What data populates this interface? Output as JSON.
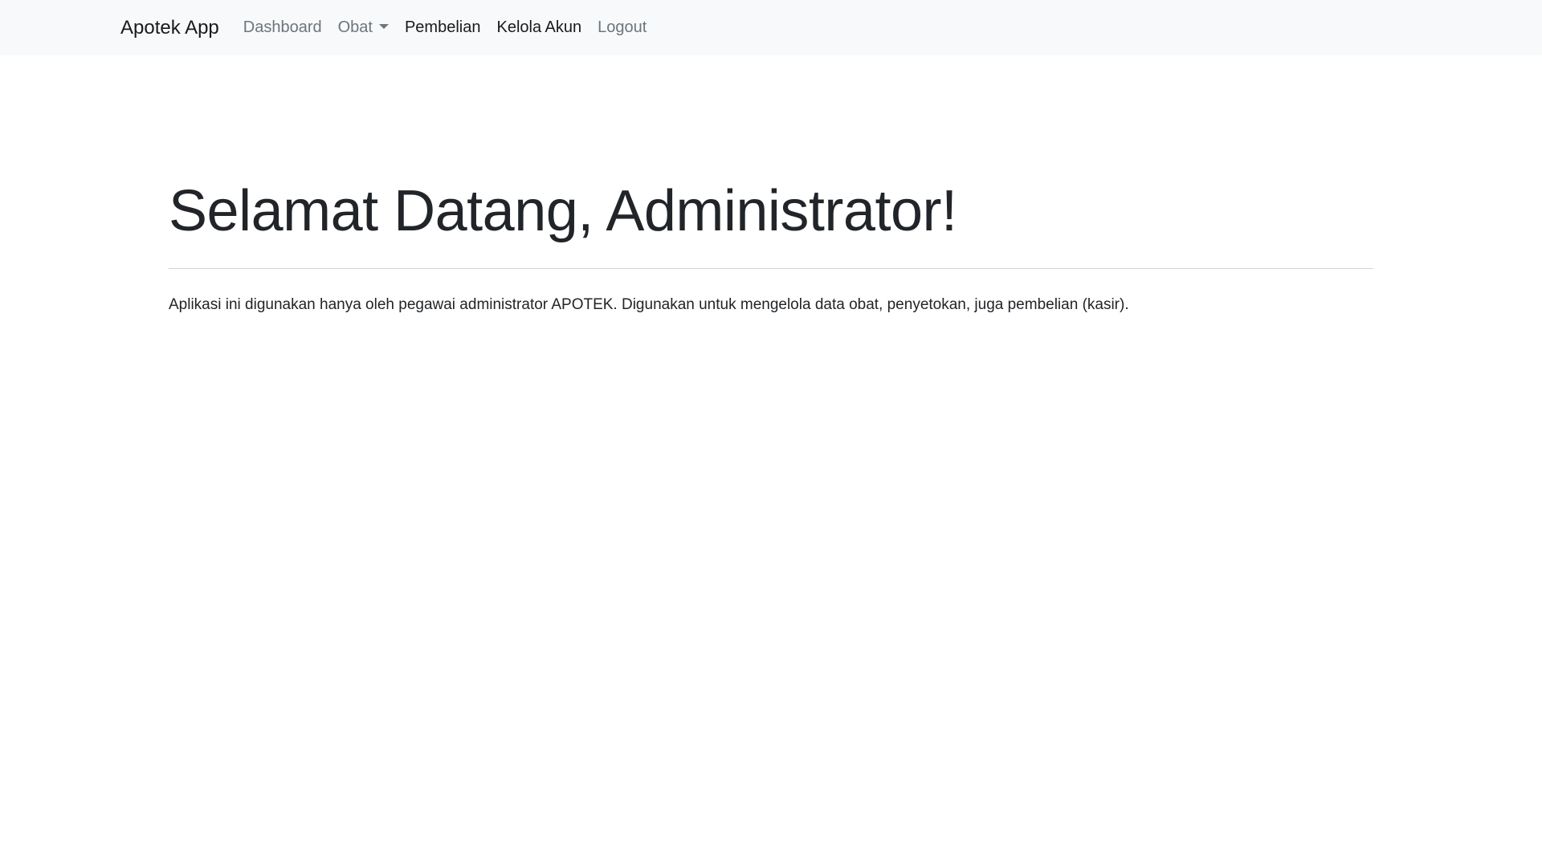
{
  "navbar": {
    "brand": "Apotek App",
    "links": [
      {
        "label": "Dashboard"
      },
      {
        "label": "Obat"
      },
      {
        "label": "Pembelian"
      },
      {
        "label": "Kelola Akun"
      },
      {
        "label": "Logout"
      }
    ]
  },
  "main": {
    "title": "Selamat Datang, Administrator!",
    "description": "Aplikasi ini digunakan hanya oleh pegawai administrator APOTEK. Digunakan untuk mengelola data obat, penyetokan, juga pembelian (kasir)."
  },
  "colors": {
    "navbar_bg": "#f8f9fa",
    "nav_muted": "#6c757d",
    "nav_active": "#1a1a1a",
    "text": "#212529"
  },
  "icons": {
    "dropdown": "chevron-down-icon"
  }
}
